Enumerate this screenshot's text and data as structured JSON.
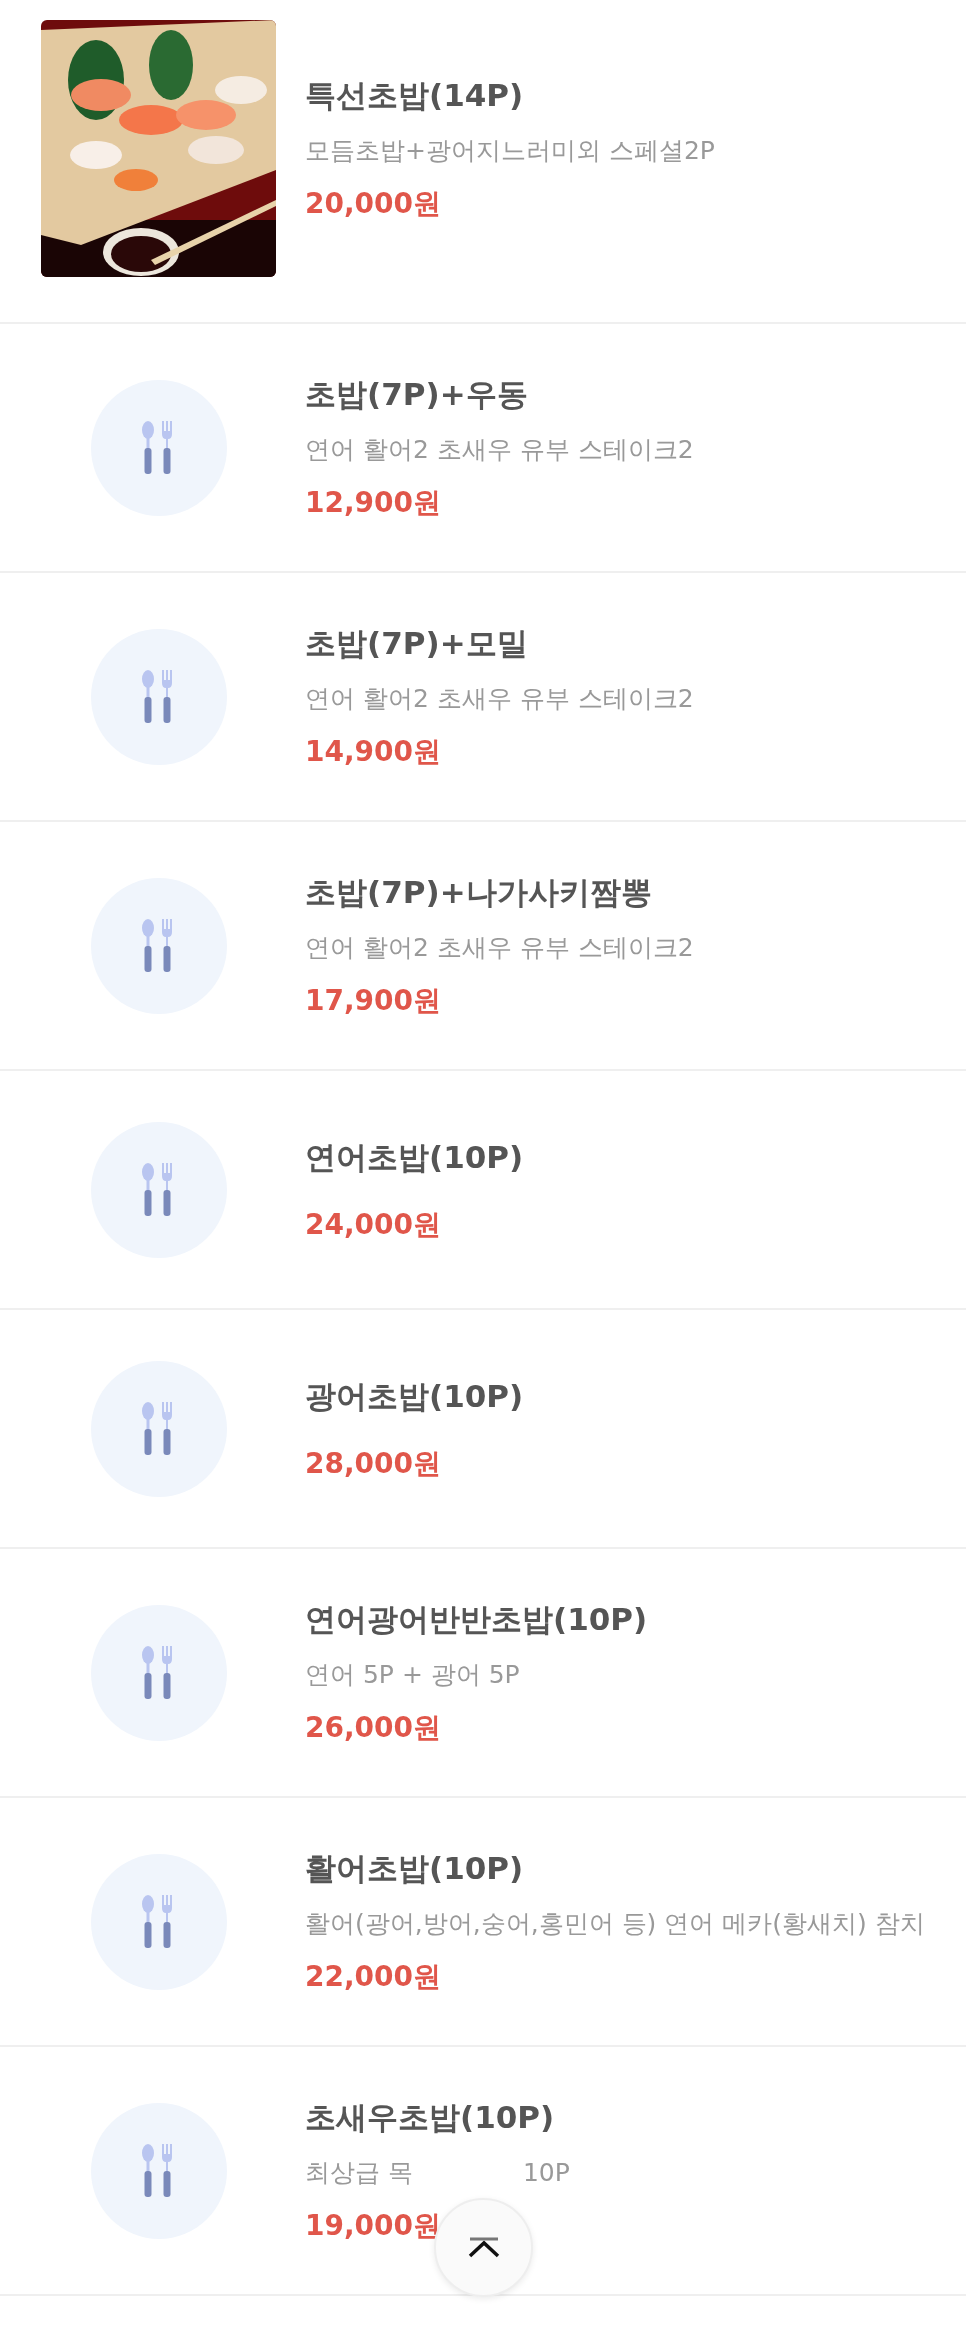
{
  "menu_items": [
    {
      "title": "특선초밥(14P)",
      "description": "모듬초밥+광어지느러미외 스페셜2P",
      "price": "20,000원"
    },
    {
      "kind": "placeholder",
      "title": "초밥(7P)+우동",
      "description": "연어 활어2 초새우 유부 스테이크2",
      "price": "12,900원"
    },
    {
      "kind": "placeholder",
      "title": "초밥(7P)+모밀",
      "description": "연어 활어2 초새우 유부 스테이크2",
      "price": "14,900원"
    },
    {
      "kind": "placeholder",
      "title": "초밥(7P)+나가사키짬뽕",
      "description": "연어 활어2 초새우 유부 스테이크2",
      "price": "17,900원"
    },
    {
      "kind": "placeholder",
      "title": "연어초밥(10P)",
      "price": "24,000원"
    },
    {
      "kind": "placeholder",
      "title": "광어초밥(10P)",
      "price": "28,000원"
    },
    {
      "kind": "placeholder",
      "title": "연어광어반반초밥(10P)",
      "description": "연어 5P + 광어 5P",
      "price": "26,000원"
    },
    {
      "kind": "placeholder",
      "title": "활어초밥(10P)",
      "description": "활어(광어,방어,숭어,홍민어 등) 연어 메카(황새치) 참치",
      "price": "22,000원"
    },
    {
      "kind": "placeholder",
      "title": "초새우초밥(10P)",
      "description_parts": [
        "최상급 목",
        "10P"
      ],
      "price": "19,000원"
    }
  ]
}
